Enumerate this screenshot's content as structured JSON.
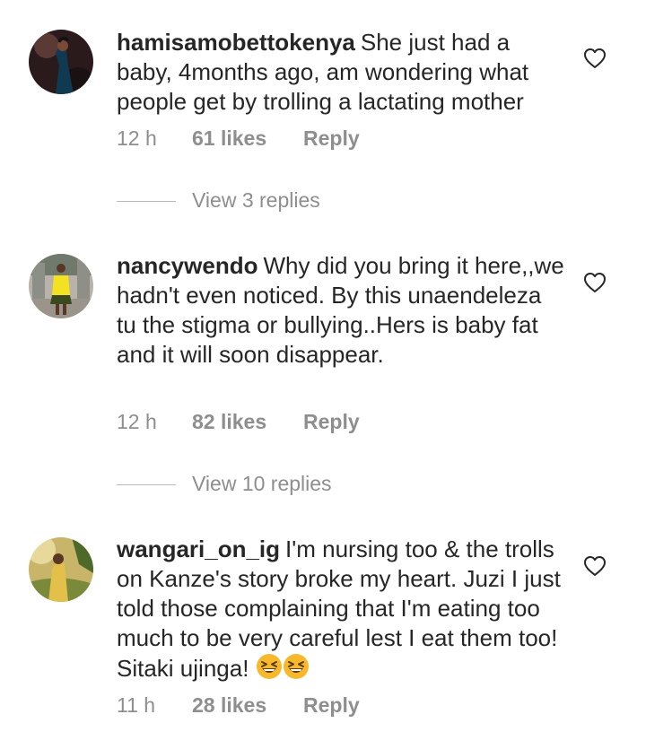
{
  "comments": [
    {
      "username": "hamisamobettokenya",
      "text": "She just had a baby, 4months ago, am wondering what people get by trolling a lactating mother",
      "time": "12 h",
      "likes": "61 likes",
      "reply_label": "Reply",
      "view_replies": "View 3 replies"
    },
    {
      "username": "nancywendo",
      "text": "Why did you bring it here,,we hadn't even noticed. By this unaendeleza tu the stigma or bullying..Hers is baby fat and it will soon disappear.",
      "time": "12 h",
      "likes": "82 likes",
      "reply_label": "Reply",
      "view_replies": "View 10 replies"
    },
    {
      "username": "wangari_on_ig",
      "text": "I'm nursing too & the trolls on Kanze's story broke my heart. Juzi I just told those complaining that I'm eating too much to be very careful lest I eat them too! Sitaki ujinga!",
      "emojis": [
        "grinning-squinting-face",
        "grinning-squinting-face"
      ],
      "time": "11 h",
      "likes": "28 likes",
      "reply_label": "Reply"
    }
  ],
  "icons": {
    "like": "heart-outline-icon"
  },
  "colors": {
    "text": "#262626",
    "muted": "#8e8e8e",
    "emoji": "#f7b92b"
  }
}
